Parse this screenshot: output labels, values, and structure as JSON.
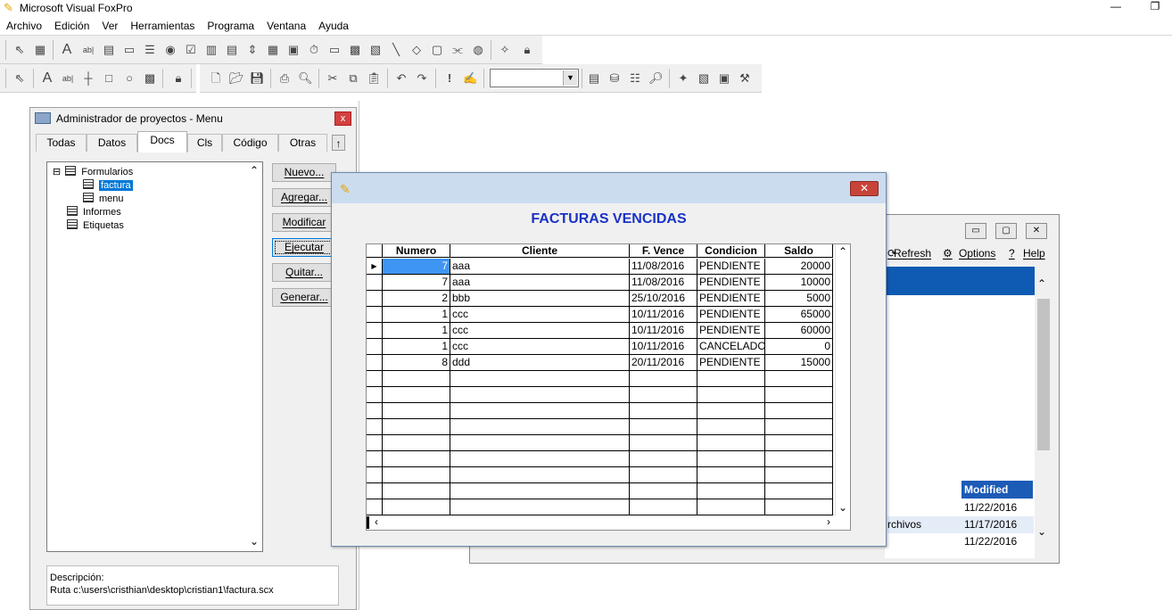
{
  "app": {
    "title": "Microsoft Visual FoxPro",
    "minimize": "—",
    "restore": "❐"
  },
  "menu": [
    "Archivo",
    "Edición",
    "Ver",
    "Herramientas",
    "Programa",
    "Ventana",
    "Ayuda"
  ],
  "project_manager": {
    "title": "Administrador de proyectos - Menu",
    "close": "x",
    "tabs": [
      "Todas",
      "Datos",
      "Docs",
      "Cls",
      "Código",
      "Otras"
    ],
    "active_tab": "Docs",
    "collapse": "↑",
    "tree": [
      {
        "label": "Formularios",
        "expander": "⊟"
      },
      {
        "label": "factura",
        "selected": true
      },
      {
        "label": "menu"
      },
      {
        "label": "Informes"
      },
      {
        "label": "Etiquetas"
      }
    ],
    "buttons": [
      "Nuevo...",
      "Agregar...",
      "Modificar",
      "Ejecutar",
      "Quitar...",
      "Generar..."
    ],
    "focused_button": "Ejecutar",
    "description_label": "Descripción:",
    "path": "Ruta c:\\users\\cristhian\\desktop\\cristian1\\factura.scx"
  },
  "back_window": {
    "toolbar": [
      "Refresh",
      "Options",
      "Help"
    ],
    "modified_header": "Modified",
    "rows": [
      {
        "name": "",
        "modified": "11/22/2016"
      },
      {
        "name": "rchivos",
        "modified": "11/17/2016"
      },
      {
        "name": "",
        "modified": "11/22/2016"
      }
    ]
  },
  "facturas_dialog": {
    "title": "FACTURAS VENCIDAS",
    "close": "✕",
    "columns": [
      "Numero",
      "Cliente",
      "F. Vence",
      "Condicion",
      "Saldo"
    ],
    "rows": [
      [
        "7",
        "aaa",
        "11/08/2016",
        "PENDIENTE",
        "20000"
      ],
      [
        "7",
        "aaa",
        "11/08/2016",
        "PENDIENTE",
        "10000"
      ],
      [
        "2",
        "bbb",
        "25/10/2016",
        "PENDIENTE",
        "5000"
      ],
      [
        "1",
        "ccc",
        "10/11/2016",
        "PENDIENTE",
        "65000"
      ],
      [
        "1",
        "ccc",
        "10/11/2016",
        "PENDIENTE",
        "60000"
      ],
      [
        "1",
        "ccc",
        "10/11/2016",
        "CANCELADO",
        "0"
      ],
      [
        "8",
        "ddd",
        "20/11/2016",
        "PENDIENTE",
        "15000"
      ]
    ],
    "empty_rows": 9,
    "current_row_marker": "▶"
  },
  "colors": {
    "accent": "#0078d7",
    "dialog_title": "#1a32c6",
    "grid_highlight": "#3f95f3",
    "banner": "#0f5bb3"
  }
}
